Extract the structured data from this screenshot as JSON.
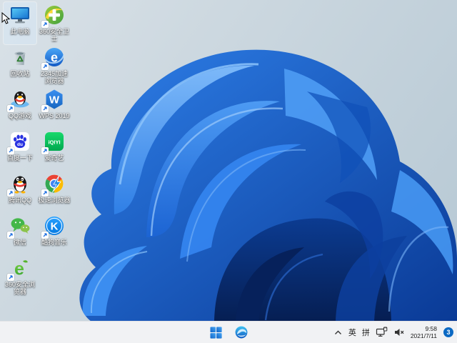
{
  "desktop": {
    "icons": [
      {
        "label": "此电脑"
      },
      {
        "label": "回收站"
      },
      {
        "label": "QQ游戏"
      },
      {
        "label": "百度一下"
      },
      {
        "label": "腾讯QQ"
      },
      {
        "label": "微信"
      },
      {
        "label": "360安全浏览器"
      },
      {
        "label": "360安全卫士"
      },
      {
        "label": "2345加速浏览器"
      },
      {
        "label": "WPS 2019"
      },
      {
        "label": "爱奇艺"
      },
      {
        "label": "极速浏览器"
      },
      {
        "label": "酷狗音乐"
      }
    ]
  },
  "taskbar": {
    "center_icons": [
      "start",
      "edge-browser"
    ],
    "tray": {
      "ime_lang": "英",
      "ime_mode": "拼",
      "time": "9:58",
      "date": "2021/7/11",
      "notifications": "3"
    }
  },
  "colors": {
    "taskbar_bg": "#f1f2f4",
    "notification_badge": "#0b69c3",
    "bloom_primary": "#1e6fe0",
    "bloom_dark": "#06215b",
    "desktop_bg_light": "#d9e1e7",
    "desktop_bg_dark": "#b6c8d4"
  }
}
